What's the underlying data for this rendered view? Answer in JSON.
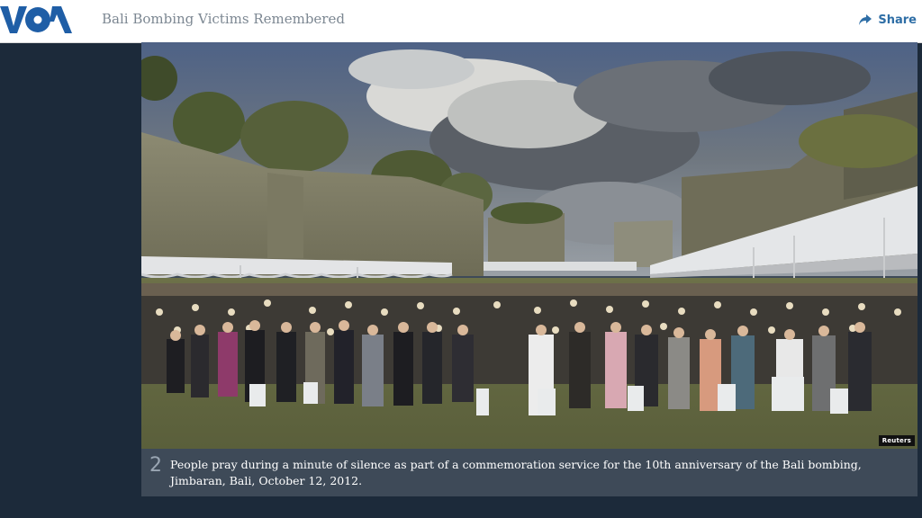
{
  "header": {
    "logo_text": "VOA",
    "title": "Bali Bombing Victims Remembered",
    "share_label": "Share",
    "share_icon": "share-arrow-icon",
    "accent_color": "#2e6ea6",
    "logo_color": "#1f5ea6"
  },
  "gallery": {
    "slide_number": "2",
    "caption": "People pray during a minute of silence as part of a commemoration service for the 10th anniversary of the Bali bombing, Jimbaran, Bali, October 12, 2012.",
    "photo_credit": "Reuters",
    "background_color": "#1c2a3a",
    "caption_bg_color": "#3e4a58"
  }
}
